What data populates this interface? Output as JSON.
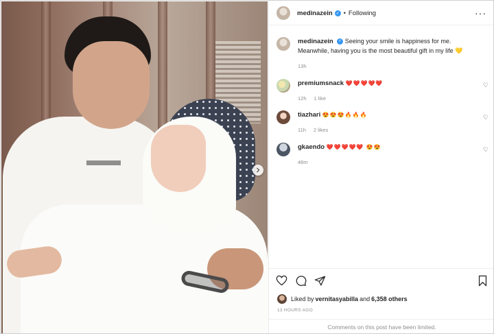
{
  "post": {
    "username": "medinazein",
    "following_label": "Following",
    "caption_user": "medinazein",
    "caption_text": "Seeing your smile is happiness for me. Meanwhile, having you is the most beautiful gift in my life",
    "caption_emoji": "💛",
    "caption_time": "13h"
  },
  "comments": [
    {
      "user": "premiumsnack",
      "text": "❤️❤️❤️❤️❤️",
      "time": "12h",
      "likes": "1 like"
    },
    {
      "user": "tiazhari",
      "text": "😍😍😍🔥🔥🔥",
      "time": "11h",
      "likes": "2 likes"
    },
    {
      "user": "gkaendo",
      "text": "❤️❤️❤️❤️❤️ 😍😍",
      "time": "48m",
      "likes": ""
    }
  ],
  "footer": {
    "liked_prefix": "Liked by ",
    "liked_user": "vernitasyabilla",
    "liked_mid": " and ",
    "liked_count": "6,358 others",
    "timestamp": "13 HOURS AGO",
    "comments_limited": "Comments on this post have been limited."
  },
  "icons": {
    "verified": "verified-badge-icon",
    "more": "more-options-icon",
    "like": "heart-icon",
    "comment": "comment-icon",
    "share": "share-icon",
    "save": "bookmark-icon",
    "next": "chevron-right-icon"
  },
  "colors": {
    "verified_blue": "#3897f0",
    "muted": "#8e8e8e",
    "text": "#262626"
  }
}
